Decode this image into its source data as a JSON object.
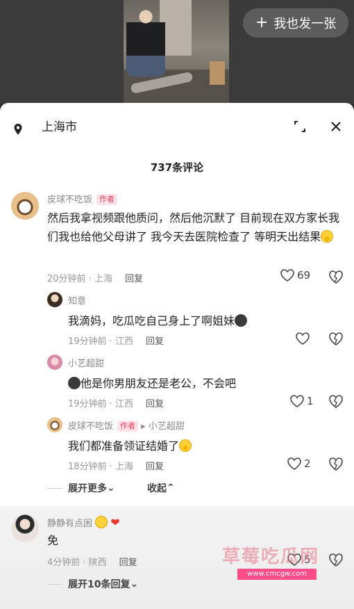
{
  "share_button": {
    "label": "我也发一张"
  },
  "sheet": {
    "location": "上海市",
    "comment_count": "737条评论"
  },
  "comments": [
    {
      "user": "皮球不吃饭",
      "badge": "作者",
      "text": "然后我拿视频跟他质问，然后他沉默了 目前现在双方家长我们我也给他父母讲了 我今天去医院检查了 等明天出结果",
      "emoji": "cry",
      "time_loc": "20分钟前 · 上海",
      "reply": "回复",
      "likes": "69"
    },
    {
      "user": "知意",
      "text": "我滴妈，吃瓜吃自己身上了啊姐妹",
      "time_loc": "19分钟前 · 江西",
      "reply": "回复",
      "likes": ""
    },
    {
      "user": "小艺超甜",
      "text": "他是你男朋友还是老公，不会吧",
      "time_loc": "19分钟前 · 江西",
      "reply": "回复",
      "likes": "1"
    },
    {
      "user": "皮球不吃饭",
      "badge": "作者",
      "reply_to": "小艺超甜",
      "text": "我们都准备领证结婚了",
      "time_loc": "18分钟前 · 上海",
      "reply": "回复",
      "likes": "2"
    },
    {
      "user": "静静有点困",
      "text": "免",
      "time_loc": "4分钟前 · 陕西",
      "reply": "回复",
      "likes": "5"
    }
  ],
  "expand_more": "展开更多",
  "collapse": "收起",
  "expand_replies": "展开10条回复",
  "watermark": {
    "text": "草莓吃瓜网",
    "url": "www.cmcgw.com"
  },
  "colors": {
    "author_badge": "#ff3b5c",
    "text": "#222222",
    "meta": "#9a9a9a"
  }
}
